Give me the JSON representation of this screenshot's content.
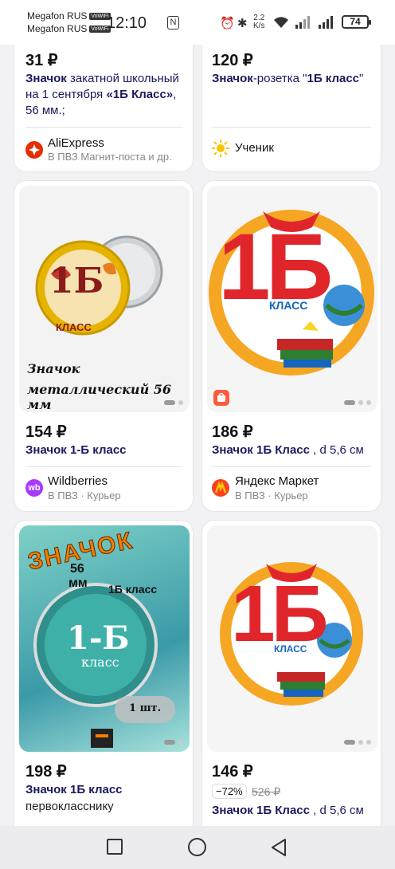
{
  "status_bar": {
    "carrier1": "Megafon RUS",
    "carrier2": "Megafon RUS",
    "carrier_tag": "VoWiFi",
    "time": "12:10",
    "net_speed_value": "2.2",
    "net_speed_unit": "K/s",
    "battery": "74"
  },
  "products": [
    {
      "price": "31 ₽",
      "title_bold1": "Значок",
      "title_rest1": " закатной школьный на 1 сентября ",
      "title_bold2": "«1Б Класс»",
      "title_rest2": ", 56 мм.;",
      "shop": "AliExpress",
      "shop_sub": "В ПВЗ Магнит-поста и др."
    },
    {
      "price": "120 ₽",
      "title_bold1": "Значок",
      "title_rest1": "-розетка \"",
      "title_bold2": "1Б класс",
      "title_rest2": "\"",
      "shop": "Ученик"
    },
    {
      "image_caption_line1": "Значок",
      "image_caption_line2": "металлический 56 мм",
      "badge_big": "1Б",
      "badge_small": "КЛАСС",
      "price": "154 ₽",
      "title": "Значок 1-Б класс",
      "shop": "Wildberries",
      "shop_sub": "В ПВЗ · Курьер"
    },
    {
      "badge_big": "1Б",
      "badge_small": "КЛАСС",
      "price": "186 ₽",
      "title_bold": "Значок 1Б Класс",
      "title_rest": " , d 5,6 см",
      "shop": "Яндекс Маркет",
      "shop_sub": "В ПВЗ · Курьер"
    },
    {
      "img_top_text": "ЗНАЧОК",
      "img_size1": "56",
      "img_size2": "мм",
      "img_class": "1Б класс",
      "img_badge_big": "1-Б",
      "img_badge_small": "класс",
      "img_qty": "1 шт.",
      "price": "198 ₽",
      "title_bold": "Значок 1Б класс",
      "title_rest": "первокласснику"
    },
    {
      "badge_big": "1Б",
      "badge_small": "КЛАСС",
      "price": "146 ₽",
      "discount": "−72%",
      "old_price": "526 ₽",
      "title_bold": "Значок 1Б Класс",
      "title_rest": " , d 5,6 см"
    }
  ],
  "colors": {
    "title": "#1a1a5e",
    "aliexpress": "#e62e04",
    "wildberries": "#a73afd",
    "yandex": "#fc3f1d"
  }
}
